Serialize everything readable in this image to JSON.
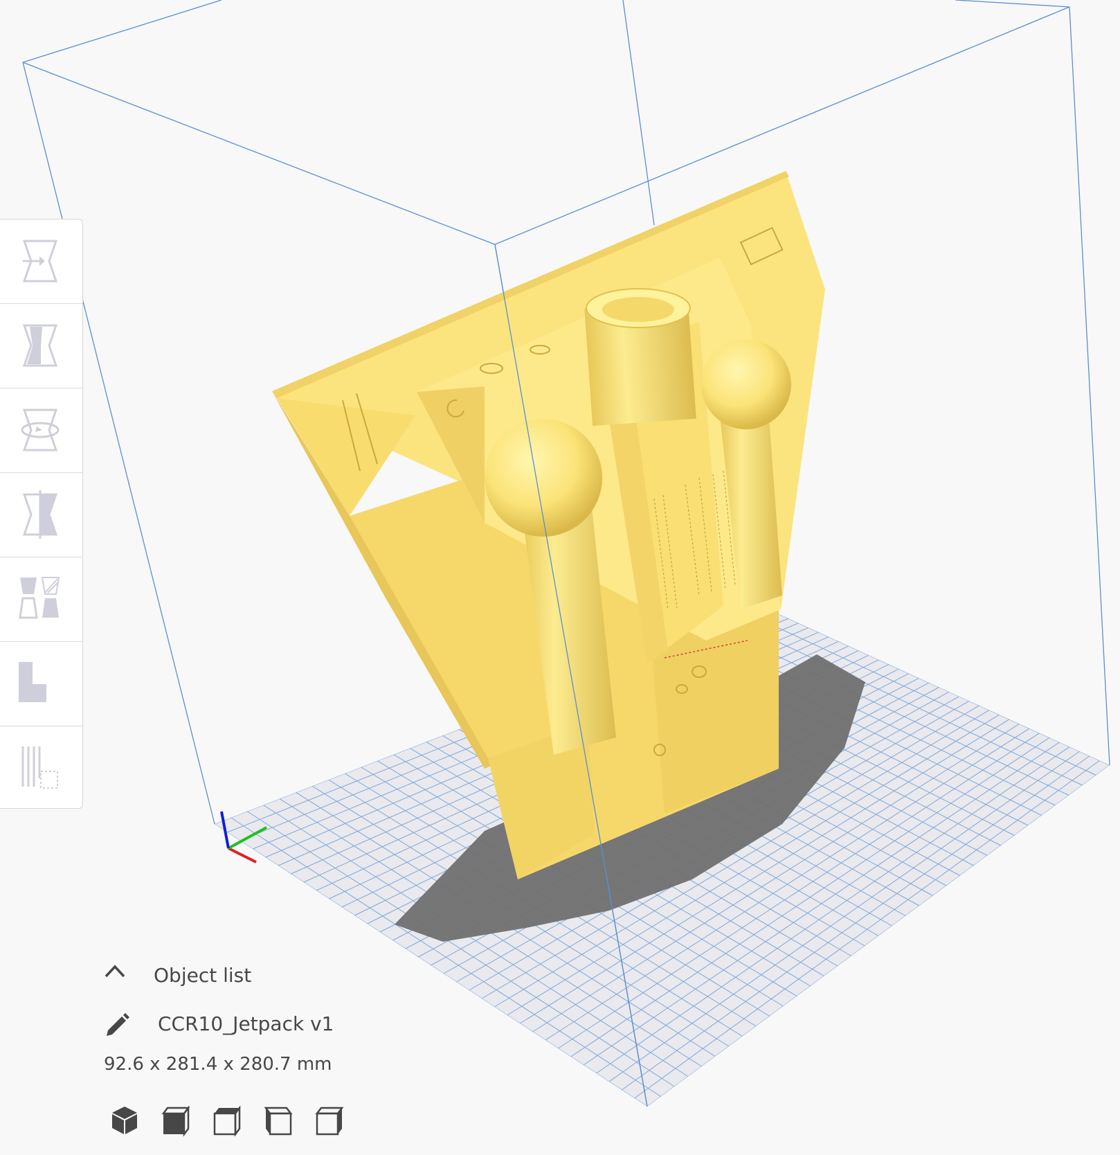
{
  "viewport": {
    "background_color": "#f8f8f8",
    "build_volume_color": "#5a8fcb",
    "model_color": "#fbe27a",
    "model_shadow_color": "#e9c95c",
    "plate_grid_color": "#6a9ad0",
    "plate_color": "#e8e8ec",
    "model_shadow_on_plate_color": "#707070",
    "axis_x_color": "#e02020",
    "axis_y_color": "#20c020",
    "axis_z_color": "#1020d0"
  },
  "toolbar": {
    "tools": [
      {
        "name": "move-tool",
        "icon": "move-icon"
      },
      {
        "name": "scale-tool",
        "icon": "scale-icon"
      },
      {
        "name": "rotate-tool",
        "icon": "rotate-icon"
      },
      {
        "name": "mirror-tool",
        "icon": "mirror-icon"
      },
      {
        "name": "per-model-settings-tool",
        "icon": "per-model-settings-icon"
      },
      {
        "name": "support-blocker-tool",
        "icon": "support-blocker-icon"
      },
      {
        "name": "custom-supports-tool",
        "icon": "custom-supports-icon"
      }
    ],
    "icon_color": "#cfcfdb"
  },
  "object_list": {
    "header_label": "Object list",
    "header_icon": "chevron-up-icon",
    "object_name": "CCR10_Jetpack v1",
    "edit_icon": "pencil-icon",
    "dimensions": "92.6 x 281.4 x 280.7 mm",
    "view_buttons": [
      {
        "name": "view-3d-button",
        "icon": "view-3d-icon"
      },
      {
        "name": "view-front-button",
        "icon": "view-front-icon"
      },
      {
        "name": "view-top-button",
        "icon": "view-top-icon"
      },
      {
        "name": "view-left-button",
        "icon": "view-left-icon"
      },
      {
        "name": "view-right-button",
        "icon": "view-right-icon"
      }
    ]
  }
}
